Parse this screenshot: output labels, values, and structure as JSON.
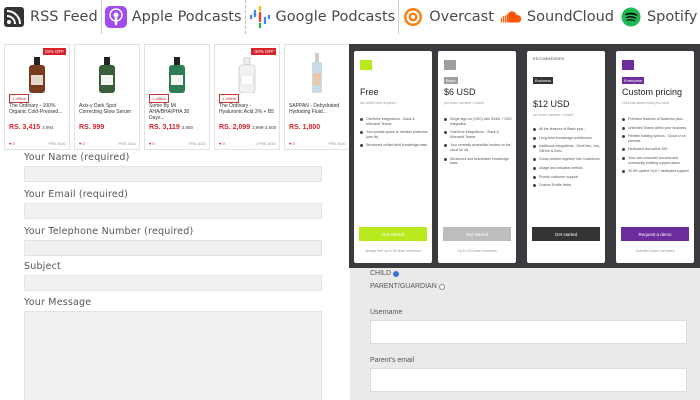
{
  "podcasts": [
    {
      "label": "RSS Feed",
      "icon": "rss-icon",
      "color": "#333333"
    },
    {
      "label": "Apple Podcasts",
      "icon": "apple-podcasts-icon",
      "color": "#9b3df0"
    },
    {
      "label": "Google Podcasts",
      "icon": "google-podcasts-icon",
      "color": "#4285f4"
    },
    {
      "label": "Overcast",
      "icon": "overcast-icon",
      "color": "#fc7e0f"
    },
    {
      "label": "SoundCloud",
      "icon": "soundcloud-icon",
      "color": "#ff5500"
    },
    {
      "label": "Spotify",
      "icon": "spotify-icon",
      "color": "#1db954"
    }
  ],
  "products": [
    {
      "discount": "15% OFF",
      "badge": "1 offline",
      "name": "The Ordinary - 100% Organic Cold-Pressed...",
      "price": "RS. 3,415",
      "old_price": "3,994",
      "likes": "0",
      "status": "PRE ADD"
    },
    {
      "discount": "",
      "badge": "",
      "name": "Axis-y Dark Spot Correcting Glow Serum",
      "price": "RS. 999",
      "old_price": "",
      "likes": "0",
      "status": "PRE ADD"
    },
    {
      "discount": "",
      "badge": "1 offline",
      "name": "Some By Mi AHA/BHA/PHA 30 Days...",
      "price": "RS. 3,119",
      "old_price": "3,800",
      "likes": "0",
      "status": "PRE ADD"
    },
    {
      "discount": "-30% OFF",
      "badge": "1 offline",
      "name": "The Ordinary - Hyaluronic Acid 2% + B5",
      "price": "RS. 2,099",
      "old_price": "2,999-3,600",
      "likes": "0",
      "status": "1 PRE ADD"
    },
    {
      "discount": "",
      "badge": "",
      "name": "SAPPAN - Dehydrated Hydrating Fluid...",
      "price": "RS. 1,800",
      "old_price": "",
      "likes": "0",
      "status": "PRE ADD"
    }
  ],
  "contact_form": {
    "name_label": "Your Name (required)",
    "email_label": "Your Email (required)",
    "phone_label": "Your Telephone Number (required)",
    "subject_label": "Subject",
    "message_label": "Your Message"
  },
  "pricing": {
    "plans": [
      {
        "tag": "",
        "name": "Free",
        "subtitle": "No credit card required",
        "features": [
          "OneDrive integrations - Slack & Microsoft Teams",
          "Your private space to mention platforms (use fix)",
          "Structured unified stuff knowledge base"
        ],
        "button": "Get started",
        "button_color": "#b8ea1e",
        "footer": "Always free up to 50 team members",
        "accent": "#b8ea1e"
      },
      {
        "tag": "Basic",
        "name": "$6 USD",
        "subtitle": "per team member / month",
        "features": [
          "Single sign-on (SSO) with SAML + SSO integration",
          "OneDrive integrations - Slack & Microsoft Teams",
          "Your centrally accessible hosted on the cloud for all",
          "Structured and searchable knowledge base"
        ],
        "button": "Get started",
        "button_color": "#bdbdbd",
        "footer": "Up to 200 team members",
        "accent": "#9e9e9e"
      },
      {
        "tag": "Business",
        "name": "$12 USD",
        "subtitle": "per team member / month",
        "recommend": "RECOMMENDED",
        "features": [
          "All the features of Basic plus...",
          "Long-form knowledge architecture",
          "Additional integrations - OneDrive, Jira, GitHub & Zoho",
          "Group content together into Collections",
          "Usage and adoption metrics",
          "Priority customer support",
          "Custom Profile fields"
        ],
        "button": "Get started",
        "button_color": "#333333",
        "footer": "",
        "accent": "#333333"
      },
      {
        "tag": "Enterprise",
        "name": "Custom pricing",
        "subtitle": "Let's talk about what you need",
        "features": [
          "Premium features of Business plus...",
          "Unlimited Teams within your business",
          "Flexible hosting options - Cloud or on premise",
          "Dedicated and active SSI",
          "Your own customer success and community building support plans",
          "99.9% uptime SLA + dedicated support"
        ],
        "button": "Request a demo",
        "button_color": "#6c2e9e",
        "footer": "Unlimited team members",
        "accent": "#6c2e9e"
      }
    ]
  },
  "registration": {
    "child_label": "CHILD",
    "parent_label": "PARENT/GUARDIAN",
    "username_label": "Username",
    "parent_email_label": "Parent's email"
  }
}
